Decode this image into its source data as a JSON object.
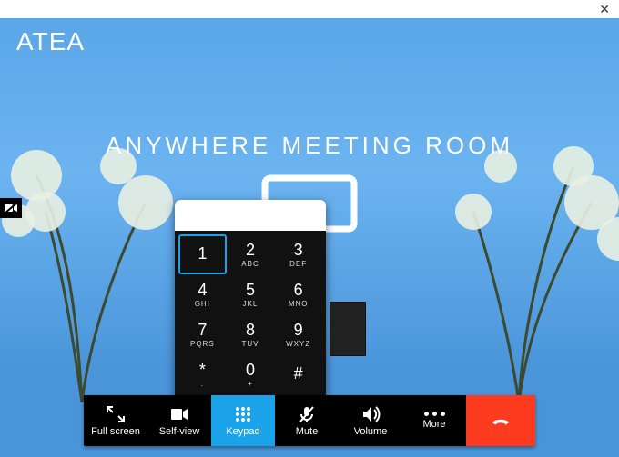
{
  "brand": "ATEA",
  "room_title": "ANYWHERE MEETING ROOM",
  "keypad": {
    "display": "",
    "keys": [
      {
        "digit": "1",
        "letters": "",
        "selected": true
      },
      {
        "digit": "2",
        "letters": "ABC"
      },
      {
        "digit": "3",
        "letters": "DEF"
      },
      {
        "digit": "4",
        "letters": "GHI"
      },
      {
        "digit": "5",
        "letters": "JKL"
      },
      {
        "digit": "6",
        "letters": "MNO"
      },
      {
        "digit": "7",
        "letters": "PQRS"
      },
      {
        "digit": "8",
        "letters": "TUV"
      },
      {
        "digit": "9",
        "letters": "WXYZ"
      },
      {
        "digit": "*",
        "letters": "."
      },
      {
        "digit": "0",
        "letters": "+"
      },
      {
        "digit": "#",
        "letters": ""
      }
    ]
  },
  "toolbar": {
    "fullscreen": "Full screen",
    "selfview": "Self-view",
    "keypad": "Keypad",
    "mute": "Mute",
    "volume": "Volume",
    "more": "More"
  },
  "icons": {
    "camera_off": "camera-off-icon"
  }
}
